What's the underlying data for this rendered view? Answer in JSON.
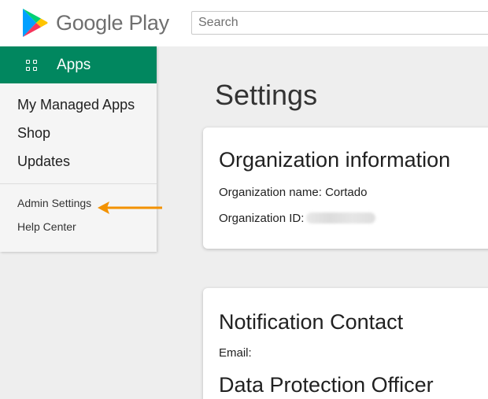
{
  "header": {
    "brand": "Google Play",
    "search_placeholder": "Search"
  },
  "sidebar": {
    "section_label": "Apps",
    "items": [
      {
        "label": "My Managed Apps"
      },
      {
        "label": "Shop"
      },
      {
        "label": "Updates"
      }
    ],
    "footer_items": [
      {
        "label": "Admin Settings"
      },
      {
        "label": "Help Center"
      }
    ]
  },
  "main": {
    "title": "Settings",
    "org_card": {
      "heading": "Organization information",
      "name_label": "Organization name: Cortado",
      "id_label": "Organization ID:"
    },
    "notify_card": {
      "heading": "Notification Contact",
      "email_label": "Email:",
      "dpo_heading": "Data Protection Officer"
    }
  },
  "colors": {
    "accent": "#01875f",
    "annotation_arrow": "#f39200",
    "background": "#eeeeee"
  },
  "icons": [
    "google-play-logo-icon",
    "apps-grid-icon",
    "annotation-arrow-icon"
  ]
}
